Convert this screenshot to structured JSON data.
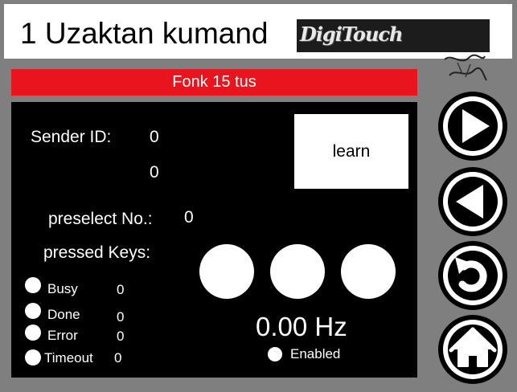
{
  "header": {
    "title": "1 Uzaktan kumand",
    "logo_text": "DigiTouch"
  },
  "banner": {
    "label": "Fonk 15 tus"
  },
  "panel": {
    "sender_id_label": "Sender ID:",
    "sender_id_value_1": "0",
    "sender_id_value_2": "0",
    "learn_label": "learn",
    "preselect_label": "preselect No.:",
    "preselect_value": "0",
    "pressed_keys_label": "pressed Keys:",
    "frequency": "0.00 Hz",
    "enabled_label": "Enabled",
    "status": [
      {
        "label": "Busy",
        "value": "0"
      },
      {
        "label": "Done",
        "value": "0"
      },
      {
        "label": "Error",
        "value": "0"
      },
      {
        "label": "Timeout",
        "value": "0"
      }
    ]
  },
  "nav": {
    "items": [
      {
        "icon": "play-right-icon"
      },
      {
        "icon": "play-left-icon"
      },
      {
        "icon": "undo-icon"
      },
      {
        "icon": "home-icon"
      }
    ]
  },
  "colors": {
    "background": "#7f7f7f",
    "banner": "#e8141e",
    "panel": "#000000",
    "white": "#ffffff"
  }
}
